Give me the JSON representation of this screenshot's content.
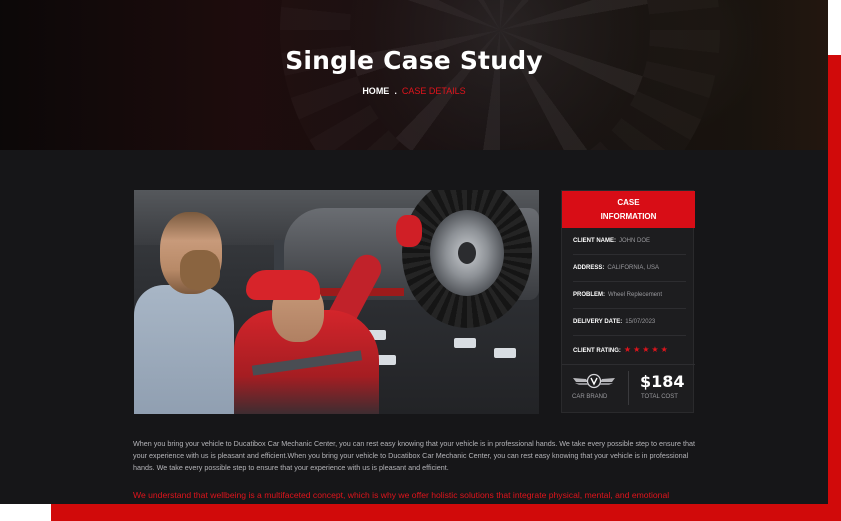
{
  "hero": {
    "title": "Single Case Study",
    "breadcrumb": {
      "home": "HOME",
      "separator": ".",
      "current": "CASE DETAILS"
    }
  },
  "case_info": {
    "heading_line1": "CASE",
    "heading_line2": "INFORMATION",
    "rows": [
      {
        "label": "CLIENT NAME:",
        "value": "JOHN DOE"
      },
      {
        "label": "ADDRESS:",
        "value": "CALIFORNIA, USA"
      },
      {
        "label": "PROBLEM:",
        "value": "Wheel Replecement"
      },
      {
        "label": "DELIVERY DATE:",
        "value": "15/07/2023"
      },
      {
        "label": "CLIENT RATING:",
        "value": "★★★★★"
      }
    ],
    "rating": 5,
    "brand_label": "CAR BRAND",
    "brand_icon": "winged-v-logo-icon",
    "cost_value": "$184",
    "cost_label": "TOTAL COST"
  },
  "content": {
    "paragraph": "When you bring your vehicle to Ducatibox Car Mechanic Center, you can rest easy knowing that your vehicle is in professional hands. We take every possible step to ensure that your experience with us is pleasant and efficient.When you bring your vehicle to Ducatibox Car Mechanic Center, you can rest easy knowing that your vehicle is in professional hands. We take every possible step to ensure that your experience with us is pleasant and efficient.",
    "highlight": "We understand that wellbeing is a multifaceted concept, which is why we offer holistic solutions that integrate physical, mental, and emotional"
  },
  "colors": {
    "accent": "#d80d16",
    "background": "#161618",
    "panel": "#1d1d1f"
  }
}
